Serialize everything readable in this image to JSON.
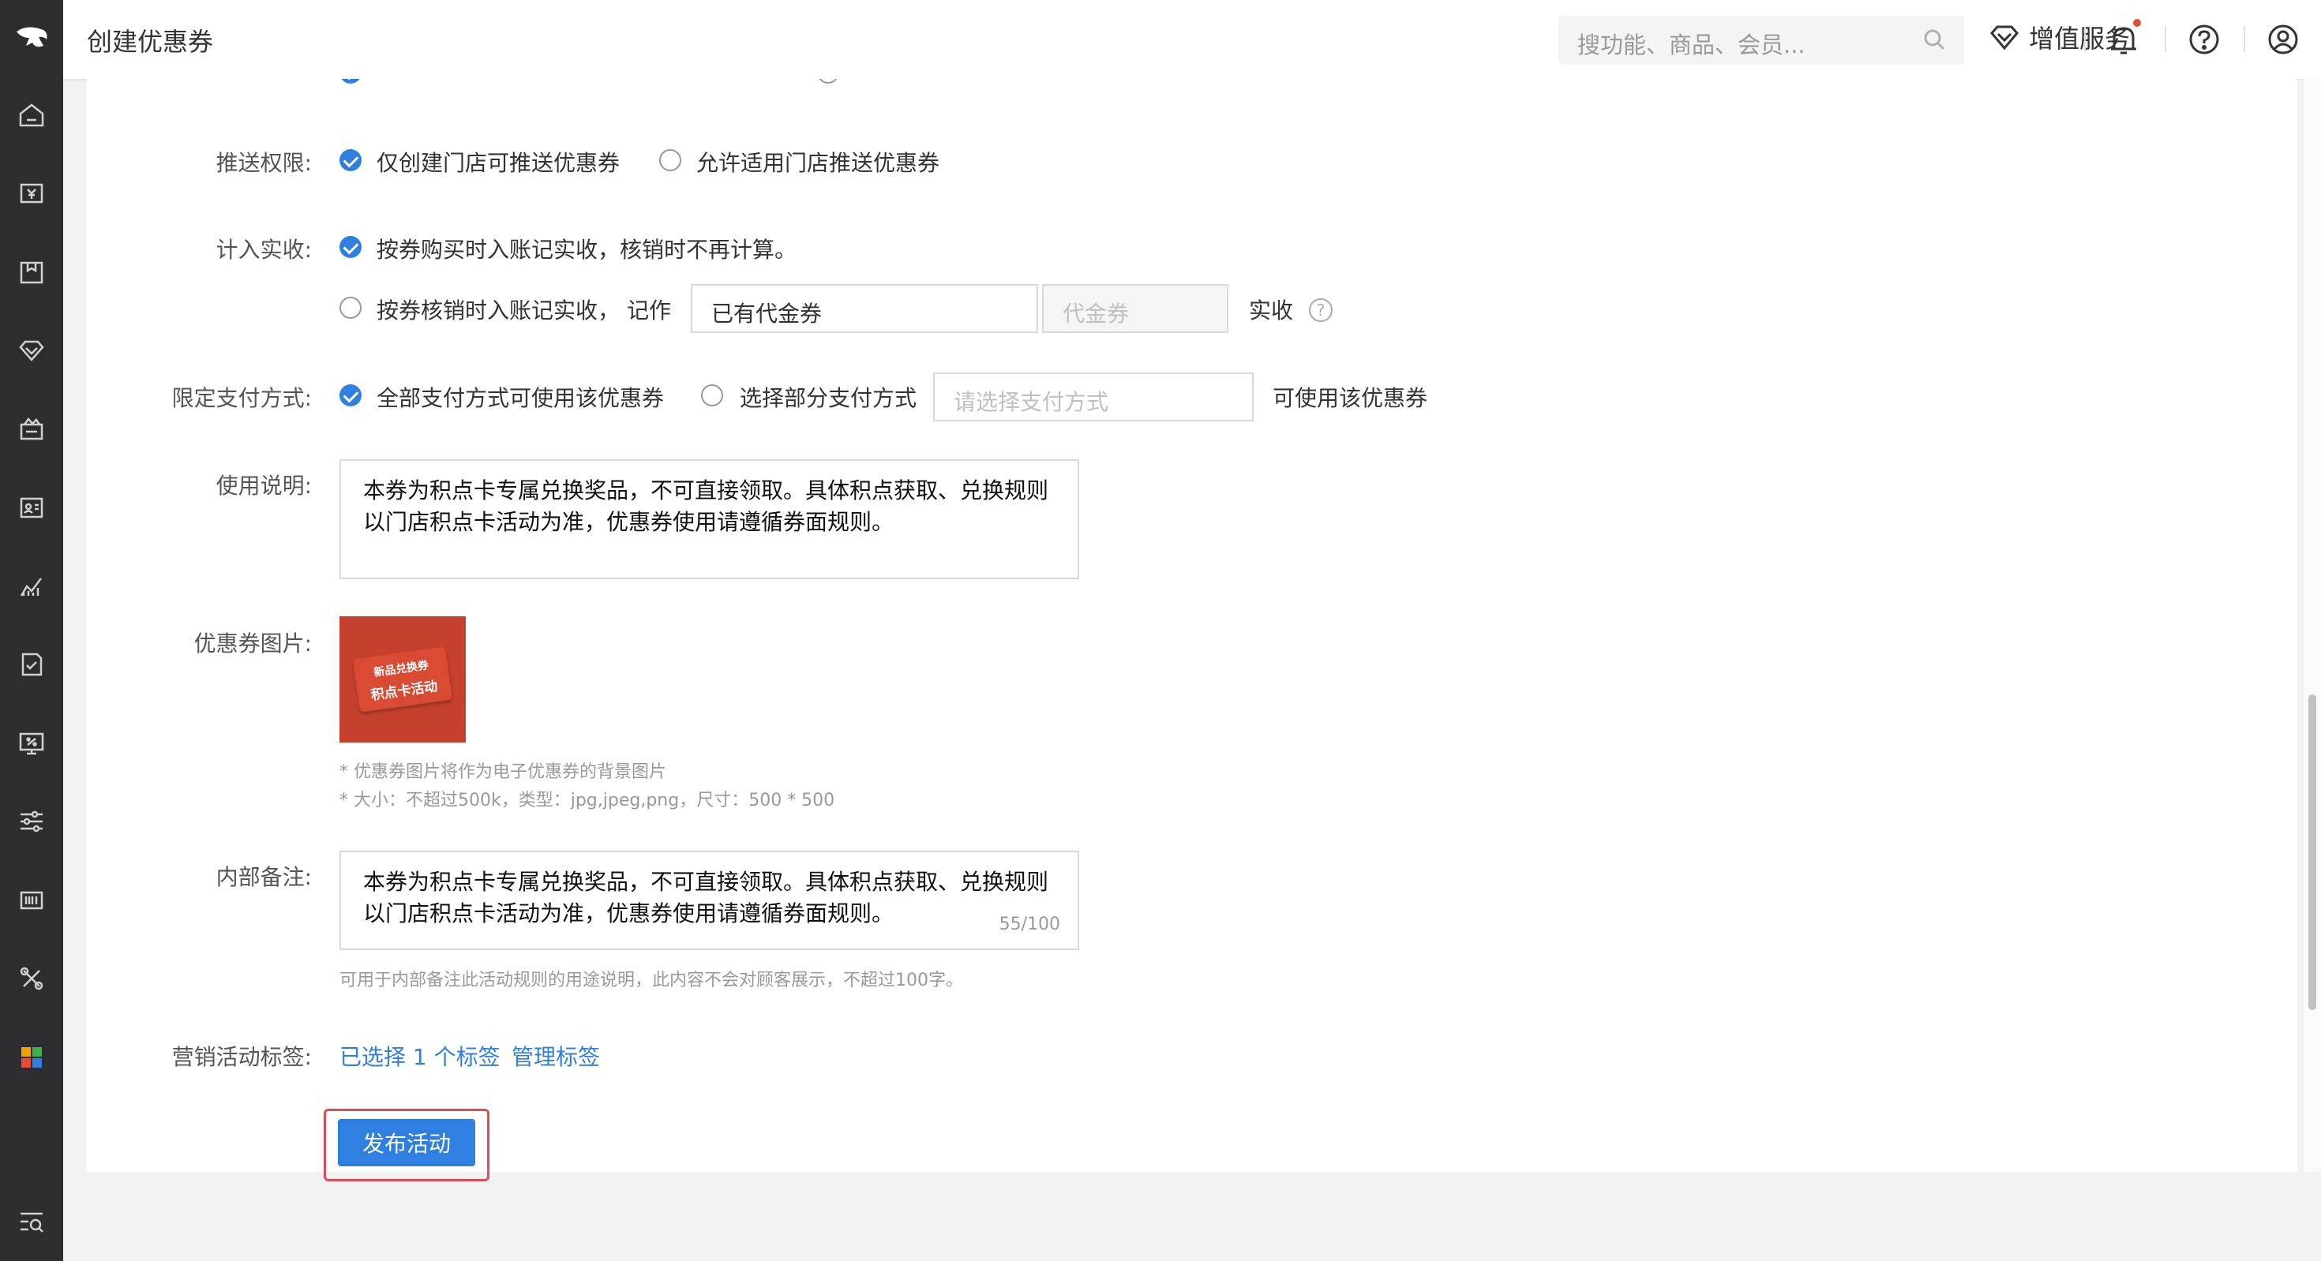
{
  "app": {
    "title": "创建优惠券",
    "search_placeholder": "搜功能、商品、会员...",
    "value_added_label": "增值服务"
  },
  "form": {
    "push_permission": {
      "label": "推送权限:",
      "options": [
        "仅创建门店可推送优惠券",
        "允许适用门店推送优惠券"
      ],
      "selected": 0
    },
    "revenue": {
      "label": "计入实收:",
      "option_a": "按券购买时入账记实收，核销时不再计算。",
      "option_b": "按券核销时入账记实收，",
      "record_as": "记作",
      "select_value": "已有代金券",
      "input_placeholder": "代金券",
      "suffix": "实收",
      "selected": 0
    },
    "payment": {
      "label": "限定支付方式:",
      "option_a": "全部支付方式可使用该优惠券",
      "option_b": "选择部分支付方式",
      "select_placeholder": "请选择支付方式",
      "suffix": "可使用该优惠券",
      "selected": 0
    },
    "usage": {
      "label": "使用说明:",
      "line1": "本券为积点卡专属兑换奖品，不可直接领取。具体积点获取、兑换规则",
      "line2": "以门店积点卡活动为准，优惠券使用请遵循券面规则。"
    },
    "image": {
      "label": "优惠券图片:",
      "coupon_line1": "新品兑换券",
      "coupon_line2": "积点卡活动",
      "hint1": "* 优惠券图片将作为电子优惠券的背景图片",
      "hint2": "* 大小：不超过500k，类型：jpg,jpeg,png，尺寸：500 * 500"
    },
    "note": {
      "label": "内部备注:",
      "line1": "本券为积点卡专属兑换奖品，不可直接领取。具体积点获取、兑换规则",
      "line2": "以门店积点卡活动为准，优惠券使用请遵循券面规则。",
      "counter": "55/100",
      "hint": "可用于内部备注此活动规则的用途说明，此内容不会对顾客展示，不超过100字。"
    },
    "tags": {
      "label": "营销活动标签:",
      "selected_text": "已选择 1 个标签",
      "manage_text": "管理标签"
    },
    "publish_label": "发布活动"
  },
  "colors": {
    "accent": "#2f7fe0",
    "sidebar_bg": "#2b2d31",
    "highlight": "#e04b55",
    "coupon_bg": "#c6412d"
  }
}
